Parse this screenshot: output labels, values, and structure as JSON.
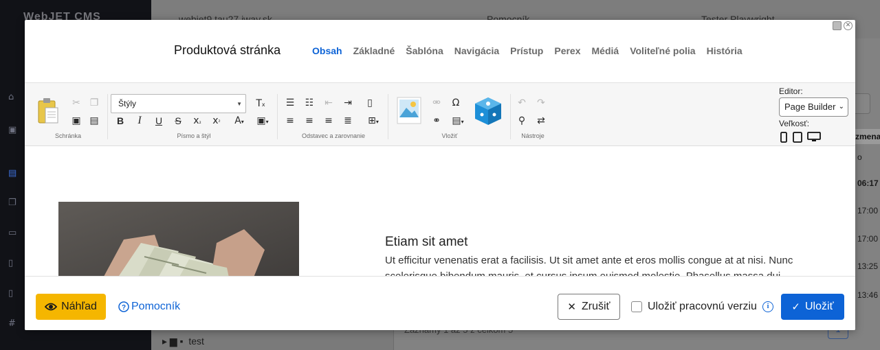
{
  "background": {
    "logo": "WebJET CMS",
    "topbar": {
      "domain": "webjet9.tau27.iway.sk",
      "help": "Pomocník",
      "user": "Tester Playwright"
    },
    "tree_item": "test",
    "table_header": "zmena",
    "filter_short": "o",
    "times": [
      "06:17",
      "17:00",
      "17:00",
      "13:25",
      "13:46"
    ],
    "records_text": "Záznamy 1 až 5 z celkom 5",
    "page": "1"
  },
  "dialog": {
    "title": "Produktová stránka",
    "tabs": [
      {
        "label": "Obsah",
        "active": true
      },
      {
        "label": "Základné"
      },
      {
        "label": "Šablóna"
      },
      {
        "label": "Navigácia"
      },
      {
        "label": "Prístup"
      },
      {
        "label": "Perex"
      },
      {
        "label": "Médiá"
      },
      {
        "label": "Voliteľné polia"
      },
      {
        "label": "História"
      }
    ],
    "toolbar": {
      "groups": {
        "clipboard": "Schránka",
        "font": "Písmo a štýl",
        "paragraph": "Odstavec a zarovnanie",
        "insert": "Vložiť",
        "tools": "Nástroje"
      },
      "styles_value": "Štýly",
      "editor_label": "Editor:",
      "editor_value": "Page Builder",
      "size_label": "Veľkosť:"
    },
    "content": {
      "heading": "Etiam sit amet",
      "text": "Ut efficitur venenatis erat a facilisis. Ut sit amet ante et eros mollis congue at at nisi. Nunc scelerisque bibendum mauris, et cursus ipsum euismod molestie. Phasellus massa dui"
    },
    "footer": {
      "preview": "Náhľad",
      "help": "Pomocník",
      "cancel": "Zrušiť",
      "save_draft": "Uložiť pracovnú verziu",
      "save": "Uložiť"
    }
  },
  "colors": {
    "accent": "#0d63d6",
    "preview_button": "#f5b600"
  }
}
